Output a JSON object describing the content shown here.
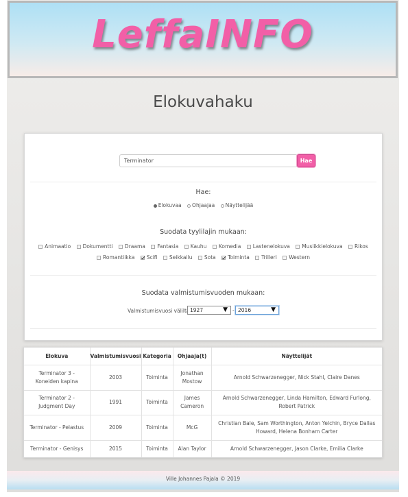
{
  "header": {
    "logo": "LeffaINFO"
  },
  "page_title": "Elokuvahaku",
  "search": {
    "value": "Terminator",
    "button_label": "Hae"
  },
  "search_by": {
    "label": "Hae:",
    "options": [
      {
        "label": "Elokuvaa",
        "selected": true
      },
      {
        "label": "Ohjaajaa",
        "selected": false
      },
      {
        "label": "Näyttelijää",
        "selected": false
      }
    ]
  },
  "genre_filter": {
    "label": "Suodata tyylilajin mukaan:",
    "genres": [
      {
        "label": "Animaatio",
        "checked": false
      },
      {
        "label": "Dokumentti",
        "checked": false
      },
      {
        "label": "Draama",
        "checked": false
      },
      {
        "label": "Fantasia",
        "checked": false
      },
      {
        "label": "Kauhu",
        "checked": false
      },
      {
        "label": "Komedia",
        "checked": false
      },
      {
        "label": "Lastenelokuva",
        "checked": false
      },
      {
        "label": "Musiikkielokuva",
        "checked": false
      },
      {
        "label": "Rikos",
        "checked": false
      },
      {
        "label": "Romantiikka",
        "checked": false
      },
      {
        "label": "Scifi",
        "checked": true
      },
      {
        "label": "Seikkailu",
        "checked": false
      },
      {
        "label": "Sota",
        "checked": false
      },
      {
        "label": "Toiminta",
        "checked": true
      },
      {
        "label": "Trilleri",
        "checked": false
      },
      {
        "label": "Western",
        "checked": false
      }
    ]
  },
  "year_filter": {
    "label": "Suodata valmistumisvuoden mukaan:",
    "range_label": "Valmistumisvuosi väliltä:",
    "from": "1927",
    "separator": "-",
    "to": "2016"
  },
  "results": {
    "columns": [
      "Elokuva",
      "Valmistumisvuosi",
      "Kategoria",
      "Ohjaaja(t)",
      "Näyttelijät"
    ],
    "rows": [
      [
        "Terminator 3 - Koneiden kapina",
        "2003",
        "Toiminta",
        "Jonathan Mostow",
        "Arnold Schwarzenegger, Nick Stahl, Claire Danes"
      ],
      [
        "Terminator 2 - Judgment Day",
        "1991",
        "Toiminta",
        "James Cameron",
        "Arnold Schwarzenegger, Linda Hamilton, Edward Furlong, Robert Patrick"
      ],
      [
        "Terminator - Pelastus",
        "2009",
        "Toiminta",
        "McG",
        "Christian Bale, Sam Worthington, Anton Yelchin, Bryce Dallas Howard, Helena Bonham Carter"
      ],
      [
        "Terminator - Genisys",
        "2015",
        "Toiminta",
        "Alan Taylor",
        "Arnold Schwarzenegger, Jason Clarke, Emilia Clarke"
      ]
    ]
  },
  "footer": {
    "text": "Ville Johannes Pajala © 2019"
  },
  "colors": {
    "accent": "#f25fa7",
    "header_top": "#aee0f5",
    "header_bottom": "#f7ece8"
  }
}
